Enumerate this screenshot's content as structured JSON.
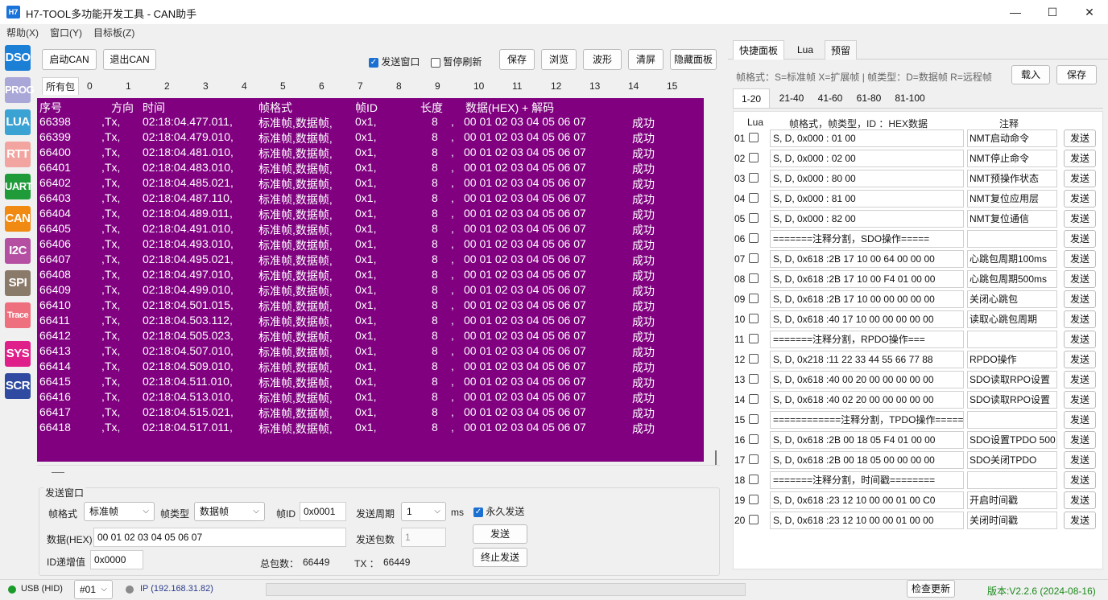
{
  "window": {
    "logo": "H7",
    "title": "H7-TOOL多功能开发工具 - CAN助手",
    "minimize": "—",
    "maximize": "☐",
    "close": "✕"
  },
  "menu": [
    "帮助(X)",
    "窗口(Y)",
    "目标板(Z)"
  ],
  "sidebar": [
    {
      "label": "DSO",
      "color": "#1b7fd6"
    },
    {
      "label": "PROG",
      "color": "#a9a6d8"
    },
    {
      "label": "LUA",
      "color": "#3aa3d4"
    },
    {
      "label": "RTT",
      "color": "#f2a4a0"
    },
    {
      "label": "UART",
      "color": "#1f9b3a"
    },
    {
      "label": "CAN",
      "color": "#f08a12"
    },
    {
      "label": "I2C",
      "color": "#b44fa2"
    },
    {
      "label": "SPI",
      "color": "#8a7a6a"
    },
    {
      "label": "Trace",
      "color": "#ee6f7e"
    },
    {
      "label": "SYS",
      "color": "#e0208a"
    },
    {
      "label": "SCR",
      "color": "#2f4aa0"
    }
  ],
  "toolbar": {
    "start_can": "启动CAN",
    "exit_can": "退出CAN",
    "send_window_label": "发送窗口",
    "send_window_checked": true,
    "pause_refresh_label": "暂停刷新",
    "pause_refresh_checked": false,
    "save": "保存",
    "browse": "浏览",
    "waveform": "波形",
    "clear": "清屏",
    "hide_panel": "隐藏面板"
  },
  "column_tabs": [
    "所有包",
    "0",
    "1",
    "2",
    "3",
    "4",
    "5",
    "6",
    "7",
    "8",
    "9",
    "10",
    "11",
    "12",
    "13",
    "14",
    "15"
  ],
  "log": {
    "header": {
      "seq": "序号",
      "dir": "方向",
      "time": "时间",
      "fmt": "帧格式",
      "id": "帧ID",
      "len": "长度",
      "data": "数据(HEX) + 解码"
    },
    "rows": [
      {
        "seq": "66398",
        "dir": "Tx,",
        "time": "02:18:04.477.011,",
        "fmt": "标准帧,数据帧,",
        "id": "0x1,",
        "len": "8",
        "data": "00 01 02 03 04 05 06 07",
        "status": "成功"
      },
      {
        "seq": "66399",
        "dir": "Tx,",
        "time": "02:18:04.479.010,",
        "fmt": "标准帧,数据帧,",
        "id": "0x1,",
        "len": "8",
        "data": "00 01 02 03 04 05 06 07",
        "status": "成功"
      },
      {
        "seq": "66400",
        "dir": "Tx,",
        "time": "02:18:04.481.010,",
        "fmt": "标准帧,数据帧,",
        "id": "0x1,",
        "len": "8",
        "data": "00 01 02 03 04 05 06 07",
        "status": "成功"
      },
      {
        "seq": "66401",
        "dir": "Tx,",
        "time": "02:18:04.483.010,",
        "fmt": "标准帧,数据帧,",
        "id": "0x1,",
        "len": "8",
        "data": "00 01 02 03 04 05 06 07",
        "status": "成功"
      },
      {
        "seq": "66402",
        "dir": "Tx,",
        "time": "02:18:04.485.021,",
        "fmt": "标准帧,数据帧,",
        "id": "0x1,",
        "len": "8",
        "data": "00 01 02 03 04 05 06 07",
        "status": "成功"
      },
      {
        "seq": "66403",
        "dir": "Tx,",
        "time": "02:18:04.487.110,",
        "fmt": "标准帧,数据帧,",
        "id": "0x1,",
        "len": "8",
        "data": "00 01 02 03 04 05 06 07",
        "status": "成功"
      },
      {
        "seq": "66404",
        "dir": "Tx,",
        "time": "02:18:04.489.011,",
        "fmt": "标准帧,数据帧,",
        "id": "0x1,",
        "len": "8",
        "data": "00 01 02 03 04 05 06 07",
        "status": "成功"
      },
      {
        "seq": "66405",
        "dir": "Tx,",
        "time": "02:18:04.491.010,",
        "fmt": "标准帧,数据帧,",
        "id": "0x1,",
        "len": "8",
        "data": "00 01 02 03 04 05 06 07",
        "status": "成功"
      },
      {
        "seq": "66406",
        "dir": "Tx,",
        "time": "02:18:04.493.010,",
        "fmt": "标准帧,数据帧,",
        "id": "0x1,",
        "len": "8",
        "data": "00 01 02 03 04 05 06 07",
        "status": "成功"
      },
      {
        "seq": "66407",
        "dir": "Tx,",
        "time": "02:18:04.495.021,",
        "fmt": "标准帧,数据帧,",
        "id": "0x1,",
        "len": "8",
        "data": "00 01 02 03 04 05 06 07",
        "status": "成功"
      },
      {
        "seq": "66408",
        "dir": "Tx,",
        "time": "02:18:04.497.010,",
        "fmt": "标准帧,数据帧,",
        "id": "0x1,",
        "len": "8",
        "data": "00 01 02 03 04 05 06 07",
        "status": "成功"
      },
      {
        "seq": "66409",
        "dir": "Tx,",
        "time": "02:18:04.499.010,",
        "fmt": "标准帧,数据帧,",
        "id": "0x1,",
        "len": "8",
        "data": "00 01 02 03 04 05 06 07",
        "status": "成功"
      },
      {
        "seq": "66410",
        "dir": "Tx,",
        "time": "02:18:04.501.015,",
        "fmt": "标准帧,数据帧,",
        "id": "0x1,",
        "len": "8",
        "data": "00 01 02 03 04 05 06 07",
        "status": "成功"
      },
      {
        "seq": "66411",
        "dir": "Tx,",
        "time": "02:18:04.503.112,",
        "fmt": "标准帧,数据帧,",
        "id": "0x1,",
        "len": "8",
        "data": "00 01 02 03 04 05 06 07",
        "status": "成功"
      },
      {
        "seq": "66412",
        "dir": "Tx,",
        "time": "02:18:04.505.023,",
        "fmt": "标准帧,数据帧,",
        "id": "0x1,",
        "len": "8",
        "data": "00 01 02 03 04 05 06 07",
        "status": "成功"
      },
      {
        "seq": "66413",
        "dir": "Tx,",
        "time": "02:18:04.507.010,",
        "fmt": "标准帧,数据帧,",
        "id": "0x1,",
        "len": "8",
        "data": "00 01 02 03 04 05 06 07",
        "status": "成功"
      },
      {
        "seq": "66414",
        "dir": "Tx,",
        "time": "02:18:04.509.010,",
        "fmt": "标准帧,数据帧,",
        "id": "0x1,",
        "len": "8",
        "data": "00 01 02 03 04 05 06 07",
        "status": "成功"
      },
      {
        "seq": "66415",
        "dir": "Tx,",
        "time": "02:18:04.511.010,",
        "fmt": "标准帧,数据帧,",
        "id": "0x1,",
        "len": "8",
        "data": "00 01 02 03 04 05 06 07",
        "status": "成功"
      },
      {
        "seq": "66416",
        "dir": "Tx,",
        "time": "02:18:04.513.010,",
        "fmt": "标准帧,数据帧,",
        "id": "0x1,",
        "len": "8",
        "data": "00 01 02 03 04 05 06 07",
        "status": "成功"
      },
      {
        "seq": "66417",
        "dir": "Tx,",
        "time": "02:18:04.515.021,",
        "fmt": "标准帧,数据帧,",
        "id": "0x1,",
        "len": "8",
        "data": "00 01 02 03 04 05 06 07",
        "status": "成功"
      },
      {
        "seq": "66418",
        "dir": "Tx,",
        "time": "02:18:04.517.011,",
        "fmt": "标准帧,数据帧,",
        "id": "0x1,",
        "len": "8",
        "data": "00 01 02 03 04 05 06 07",
        "status": "成功"
      }
    ]
  },
  "send_panel": {
    "title": "发送窗口",
    "frame_format_label": "帧格式",
    "frame_format_value": "标准帧",
    "frame_type_label": "帧类型",
    "frame_type_value": "数据帧",
    "frame_id_label": "帧ID",
    "frame_id_value": "0x0001",
    "period_label": "发送周期",
    "period_value": "1",
    "period_unit": "ms",
    "forever_label": "永久发送",
    "forever_checked": true,
    "data_label": "数据(HEX)",
    "data_value": "00 01 02 03 04 05 06 07",
    "count_label": "发送包数",
    "count_value": "1",
    "send_button": "发送",
    "id_inc_label": "ID递增值",
    "id_inc_value": "0x0000",
    "total_label": "总包数：",
    "total_value": "66449",
    "tx_label": "TX ：",
    "tx_value": "66449",
    "stop_button": "终止发送"
  },
  "quick_panel": {
    "tabs": [
      "快捷面板",
      "Lua",
      "预留"
    ],
    "hint": "帧格式：S=标准帧 X=扩展帧 | 帧类型：D=数据帧 R=远程帧",
    "load_button": "载入",
    "save_button": "保存",
    "page_tabs": [
      "1-20",
      "21-40",
      "41-60",
      "61-80",
      "81-100"
    ],
    "col_lua": "Lua",
    "col_frame": "帧格式，帧类型，ID ：HEX数据",
    "col_note": "注释",
    "send_label": "发送",
    "rows": [
      {
        "num": "01",
        "frame": "S, D, 0x000 : 01 00",
        "note": "NMT启动命令"
      },
      {
        "num": "02",
        "frame": "S, D, 0x000 : 02 00",
        "note": "NMT停止命令"
      },
      {
        "num": "03",
        "frame": "S, D, 0x000 : 80 00",
        "note": "NMT预操作状态"
      },
      {
        "num": "04",
        "frame": "S, D, 0x000 : 81 00",
        "note": "NMT复位应用层"
      },
      {
        "num": "05",
        "frame": "S, D, 0x000 : 82 00",
        "note": "NMT复位通信"
      },
      {
        "num": "06",
        "frame": "=======注释分割，SDO操作=====",
        "note": ""
      },
      {
        "num": "07",
        "frame": "S, D, 0x618 :2B 17 10 00 64 00 00 00",
        "note": "心跳包周期100ms"
      },
      {
        "num": "08",
        "frame": "S, D, 0x618 :2B 17 10 00 F4 01 00 00",
        "note": "心跳包周期500ms"
      },
      {
        "num": "09",
        "frame": "S, D, 0x618 :2B 17 10 00 00 00 00 00",
        "note": "关闭心跳包"
      },
      {
        "num": "10",
        "frame": "S, D, 0x618 :40 17 10 00 00 00 00 00",
        "note": "读取心跳包周期"
      },
      {
        "num": "11",
        "frame": "=======注释分割，RPDO操作===",
        "note": ""
      },
      {
        "num": "12",
        "frame": "S, D, 0x218 :11 22 33 44 55 66 77 88",
        "note": "RPDO操作"
      },
      {
        "num": "13",
        "frame": "S, D, 0x618 :40 00 20 00 00 00 00 00",
        "note": "SDO读取RPO设置"
      },
      {
        "num": "14",
        "frame": "S, D, 0x618 :40 02 20 00 00 00 00 00",
        "note": "SDO读取RPO设置"
      },
      {
        "num": "15",
        "frame": "============注释分割，TPDO操作=====",
        "note": ""
      },
      {
        "num": "16",
        "frame": "S, D, 0x618 :2B 00 18 05 F4 01 00 00",
        "note": "SDO设置TPDO 500"
      },
      {
        "num": "17",
        "frame": "S, D, 0x618 :2B 00 18 05 00 00 00 00",
        "note": "SDO关闭TPDO"
      },
      {
        "num": "18",
        "frame": "=======注释分割，时间戳========",
        "note": ""
      },
      {
        "num": "19",
        "frame": "S, D, 0x618 :23 12 10 00 00 01 00 C0",
        "note": "开启时间戳"
      },
      {
        "num": "20",
        "frame": "S, D, 0x618 :23 12 10 00 00 01 00 00",
        "note": "关闭时间戳"
      }
    ]
  },
  "status": {
    "usb_label": "USB (HID)",
    "usb_color": "#1a9b2a",
    "device_select": "#01",
    "ip_label": "IP (192.168.31.82)",
    "ip_color": "#8a8a8a",
    "check_update": "检查更新",
    "version": "版本:V2.2.6 (2024-08-16)",
    "version_color": "#1a8a1a"
  }
}
